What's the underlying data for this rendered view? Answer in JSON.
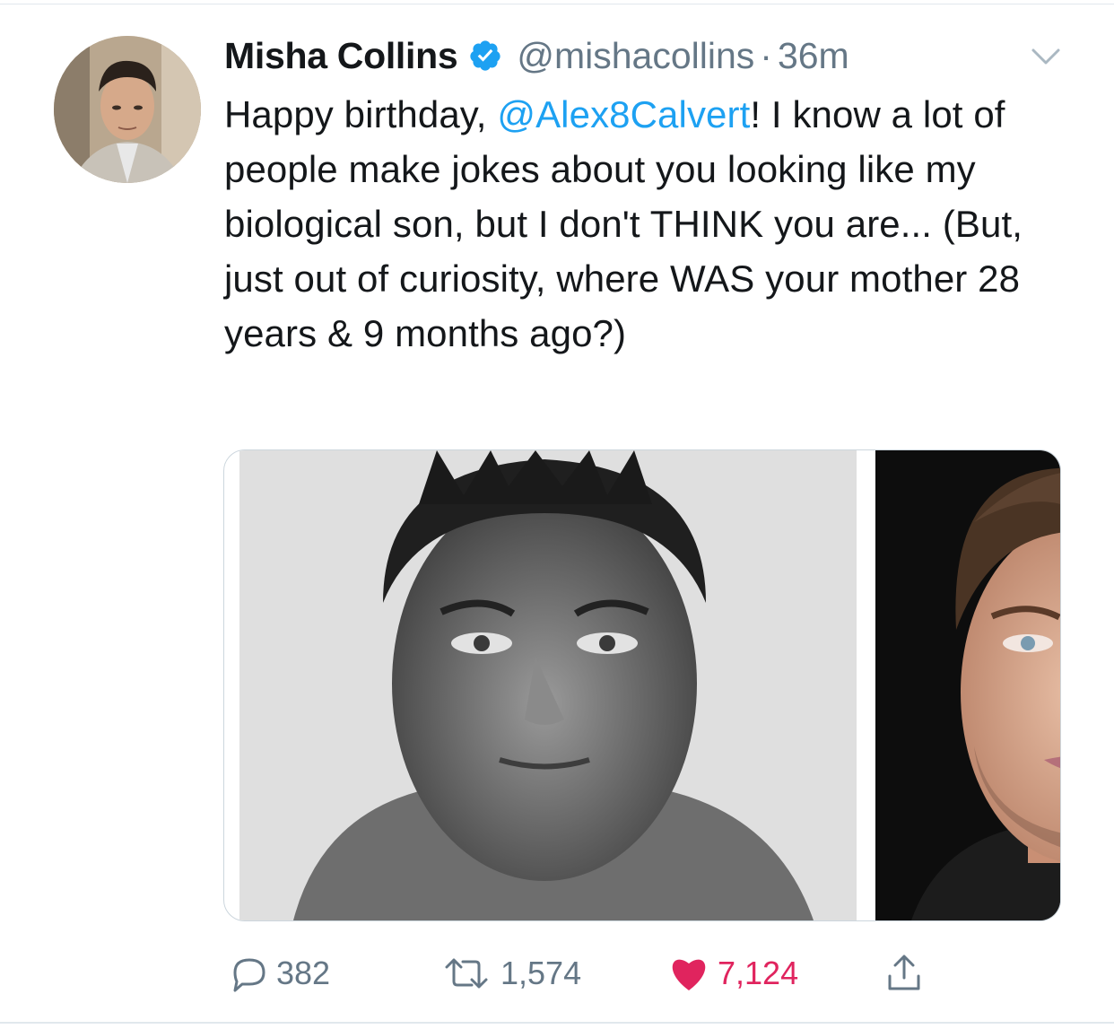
{
  "tweet": {
    "author_name": "Misha Collins",
    "handle": "@mishacollins",
    "separator": "·",
    "time": "36m",
    "text_before": "Happy birthday, ",
    "mention": "@Alex8Calvert",
    "text_after": "! I know a lot of people make jokes about you looking like my biological son, but I don't THINK you are... (But, just out of curiosity, where WAS your mother 28 years & 9 months ago?)"
  },
  "icons": {
    "verified": "verified-badge-icon",
    "menu": "chevron-down-icon",
    "reply": "reply-icon",
    "retweet": "retweet-icon",
    "like": "heart-icon",
    "share": "share-icon"
  },
  "actions": {
    "replies": "382",
    "retweets": "1,574",
    "likes": "7,124"
  },
  "colors": {
    "link": "#1da1f2",
    "like": "#e0245e",
    "muted": "#657786",
    "text": "#14171a"
  }
}
